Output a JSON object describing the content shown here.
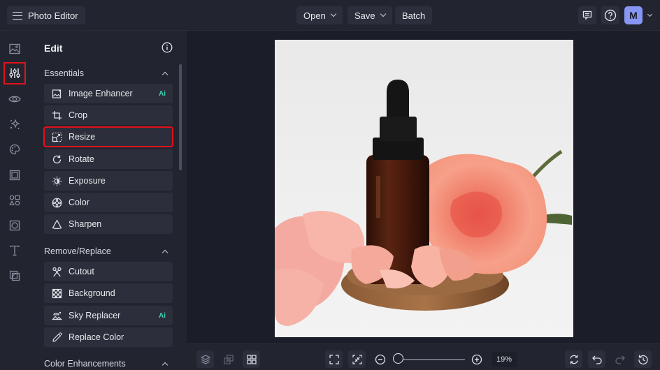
{
  "topbar": {
    "menu_icon": "hamburger-icon",
    "app_title": "Photo Editor",
    "open_label": "Open",
    "save_label": "Save",
    "batch_label": "Batch",
    "feedback_icon": "feedback-icon",
    "help_icon": "help-icon",
    "avatar_initial": "M",
    "avatar_color": "#8795f4"
  },
  "rail": {
    "items": [
      {
        "name": "image",
        "icon": "image-icon"
      },
      {
        "name": "edit",
        "icon": "sliders-icon",
        "active": true
      },
      {
        "name": "touch-up",
        "icon": "eye-icon"
      },
      {
        "name": "effects",
        "icon": "sparkle-icon"
      },
      {
        "name": "artsy",
        "icon": "palette-icon"
      },
      {
        "name": "frames",
        "icon": "frame-icon"
      },
      {
        "name": "graphics",
        "icon": "shapes-icon"
      },
      {
        "name": "textures",
        "icon": "texture-icon"
      },
      {
        "name": "text",
        "icon": "text-icon"
      },
      {
        "name": "overlays",
        "icon": "overlay-icon"
      }
    ]
  },
  "panel": {
    "title": "Edit",
    "info_icon": "info-icon",
    "sections": [
      {
        "title": "Essentials",
        "tools": [
          {
            "label": "Image Enhancer",
            "icon": "image-enhancer-icon",
            "badge": "Ai"
          },
          {
            "label": "Crop",
            "icon": "crop-icon"
          },
          {
            "label": "Resize",
            "icon": "resize-icon",
            "selected": true
          },
          {
            "label": "Rotate",
            "icon": "rotate-icon"
          },
          {
            "label": "Exposure",
            "icon": "exposure-icon"
          },
          {
            "label": "Color",
            "icon": "color-icon"
          },
          {
            "label": "Sharpen",
            "icon": "sharpen-icon"
          }
        ]
      },
      {
        "title": "Remove/Replace",
        "tools": [
          {
            "label": "Cutout",
            "icon": "scissors-icon"
          },
          {
            "label": "Background",
            "icon": "checker-icon"
          },
          {
            "label": "Sky Replacer",
            "icon": "sky-icon",
            "badge": "Ai"
          },
          {
            "label": "Replace Color",
            "icon": "eyedropper-icon"
          }
        ]
      },
      {
        "title": "Color Enhancements",
        "tools": []
      }
    ]
  },
  "canvas": {
    "image_description": "Amber dropper bottle with peach roses on a wooden dish"
  },
  "bottombar": {
    "zoom_percent": "19%",
    "zoom_level": 19
  },
  "colors": {
    "highlight": "#e3111b",
    "ai_badge": "#3fd0b3",
    "background": "#1b1d28",
    "panel": "#22252f"
  }
}
